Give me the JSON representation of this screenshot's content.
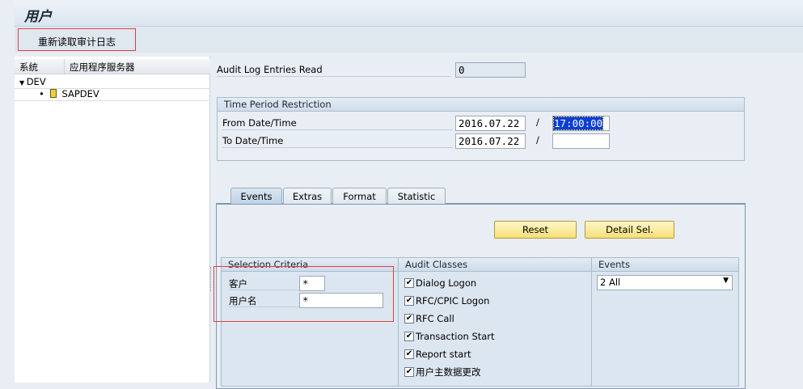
{
  "title": "用户",
  "toolbar": {
    "reread_label": "重新读取审计日志"
  },
  "tree": {
    "col_system": "系统",
    "col_server": "应用程序服务器",
    "system": "DEV",
    "server": "SAPDEV"
  },
  "entries": {
    "label": "Audit Log Entries Read",
    "value": "0"
  },
  "time": {
    "title": "Time Period Restriction",
    "from_label": "From Date/Time",
    "from_date": "2016.07.22",
    "from_time": "17:00:00",
    "to_label": "To Date/Time",
    "to_date": "2016.07.22",
    "to_time": "",
    "sep": "/"
  },
  "tabs": [
    {
      "label": "Events"
    },
    {
      "label": "Extras"
    },
    {
      "label": "Format"
    },
    {
      "label": "Statistic"
    }
  ],
  "buttons": {
    "reset": "Reset",
    "detail": "Detail Sel."
  },
  "criteria": {
    "title": "Selection Criteria",
    "client_label": "客户",
    "client_value": "*",
    "user_label": "用户名",
    "user_value": "*"
  },
  "audit": {
    "title": "Audit Classes",
    "items": [
      {
        "label": "Dialog Logon",
        "checked": true
      },
      {
        "label": "RFC/CPIC Logon",
        "checked": true
      },
      {
        "label": "RFC Call",
        "checked": true
      },
      {
        "label": "Transaction Start",
        "checked": true
      },
      {
        "label": "Report start",
        "checked": true
      },
      {
        "label": "用户主数据更改",
        "checked": true
      }
    ]
  },
  "events": {
    "title": "Events",
    "selected": "2 All"
  },
  "colors": {
    "highlight": "#0a3fd6",
    "button": "#f6df78",
    "annotation": "#e04040"
  }
}
